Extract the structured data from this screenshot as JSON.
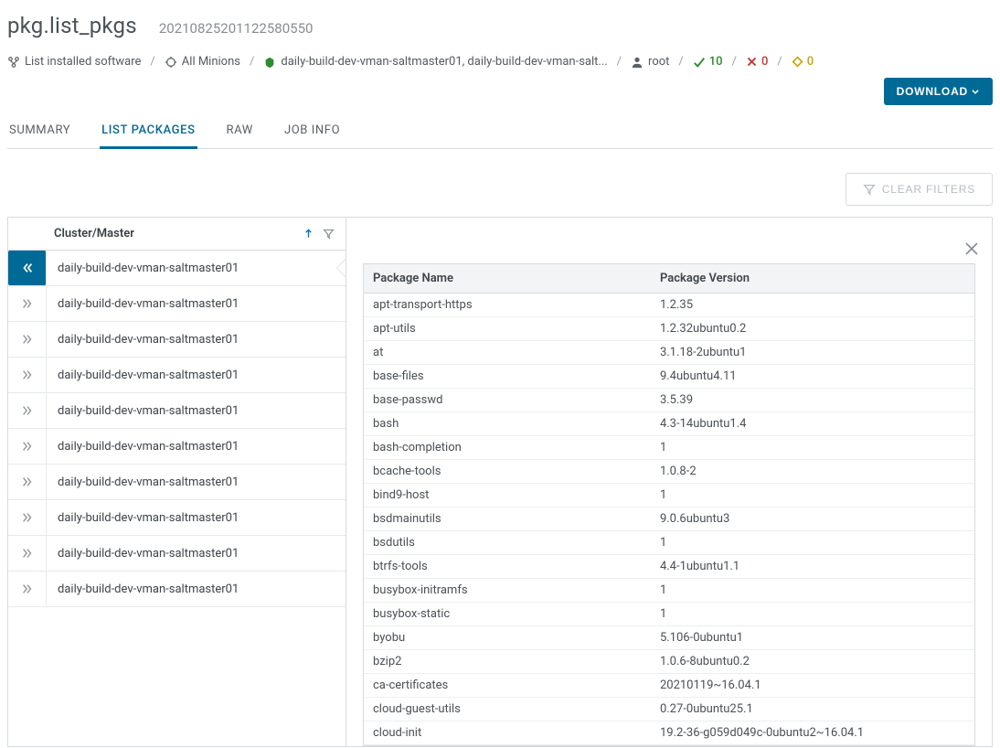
{
  "header": {
    "title": "pkg.list_pkgs",
    "job_id": "20210825201122580550"
  },
  "breadcrumb": {
    "software": "List installed software",
    "target": "All Minions",
    "minions": "daily-build-dev-vman-saltmaster01, daily-build-dev-vman-salt...",
    "user": "root",
    "success_count": "10",
    "fail_count": "0",
    "changes_count": "0"
  },
  "actions": {
    "download_label": "DOWNLOAD",
    "clear_filters_label": "CLEAR FILTERS"
  },
  "tabs": {
    "summary": "SUMMARY",
    "list_packages": "LIST PACKAGES",
    "raw": "RAW",
    "job_info": "JOB INFO"
  },
  "left": {
    "header": "Cluster/Master",
    "items": [
      "daily-build-dev-vman-saltmaster01",
      "daily-build-dev-vman-saltmaster01",
      "daily-build-dev-vman-saltmaster01",
      "daily-build-dev-vman-saltmaster01",
      "daily-build-dev-vman-saltmaster01",
      "daily-build-dev-vman-saltmaster01",
      "daily-build-dev-vman-saltmaster01",
      "daily-build-dev-vman-saltmaster01",
      "daily-build-dev-vman-saltmaster01",
      "daily-build-dev-vman-saltmaster01"
    ]
  },
  "packages": {
    "col_name": "Package Name",
    "col_version": "Package Version",
    "rows": [
      {
        "name": "apt-transport-https",
        "version": "1.2.35"
      },
      {
        "name": "apt-utils",
        "version": "1.2.32ubuntu0.2"
      },
      {
        "name": "at",
        "version": "3.1.18-2ubuntu1"
      },
      {
        "name": "base-files",
        "version": "9.4ubuntu4.11"
      },
      {
        "name": "base-passwd",
        "version": "3.5.39"
      },
      {
        "name": "bash",
        "version": "4.3-14ubuntu1.4"
      },
      {
        "name": "bash-completion",
        "version": "1"
      },
      {
        "name": "bcache-tools",
        "version": "1.0.8-2"
      },
      {
        "name": "bind9-host",
        "version": "1"
      },
      {
        "name": "bsdmainutils",
        "version": "9.0.6ubuntu3"
      },
      {
        "name": "bsdutils",
        "version": "1"
      },
      {
        "name": "btrfs-tools",
        "version": "4.4-1ubuntu1.1"
      },
      {
        "name": "busybox-initramfs",
        "version": "1"
      },
      {
        "name": "busybox-static",
        "version": "1"
      },
      {
        "name": "byobu",
        "version": "5.106-0ubuntu1"
      },
      {
        "name": "bzip2",
        "version": "1.0.6-8ubuntu0.2"
      },
      {
        "name": "ca-certificates",
        "version": "20210119~16.04.1"
      },
      {
        "name": "cloud-guest-utils",
        "version": "0.27-0ubuntu25.1"
      },
      {
        "name": "cloud-init",
        "version": "19.2-36-g059d049c-0ubuntu2~16.04.1"
      }
    ]
  }
}
